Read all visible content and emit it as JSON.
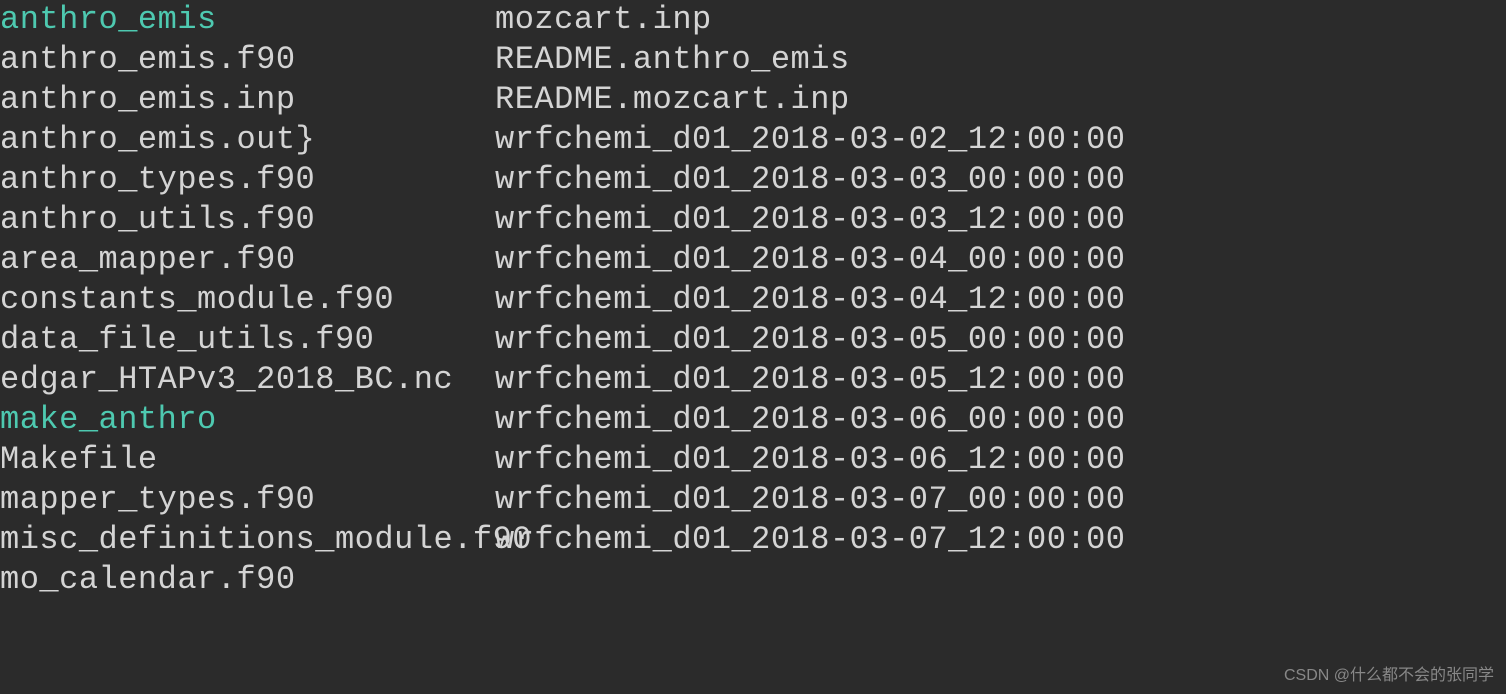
{
  "listing": {
    "col1": [
      {
        "name": "anthro_emis",
        "type": "executable"
      },
      {
        "name": "anthro_emis.f90",
        "type": "regular"
      },
      {
        "name": "anthro_emis.inp",
        "type": "regular"
      },
      {
        "name": "anthro_emis.out}",
        "type": "regular"
      },
      {
        "name": "anthro_types.f90",
        "type": "regular"
      },
      {
        "name": "anthro_utils.f90",
        "type": "regular"
      },
      {
        "name": "area_mapper.f90",
        "type": "regular"
      },
      {
        "name": "constants_module.f90",
        "type": "regular"
      },
      {
        "name": "data_file_utils.f90",
        "type": "regular"
      },
      {
        "name": "edgar_HTAPv3_2018_BC.nc",
        "type": "regular"
      },
      {
        "name": "make_anthro",
        "type": "executable"
      },
      {
        "name": "Makefile",
        "type": "regular"
      },
      {
        "name": "mapper_types.f90",
        "type": "regular"
      },
      {
        "name": "misc_definitions_module.f90",
        "type": "regular"
      },
      {
        "name": "mo_calendar.f90",
        "type": "regular"
      }
    ],
    "col2": [
      {
        "name": "mozcart.inp",
        "type": "regular"
      },
      {
        "name": "README.anthro_emis",
        "type": "regular"
      },
      {
        "name": "README.mozcart.inp",
        "type": "regular"
      },
      {
        "name": "wrfchemi_d01_2018-03-02_12:00:00",
        "type": "regular"
      },
      {
        "name": "wrfchemi_d01_2018-03-03_00:00:00",
        "type": "regular"
      },
      {
        "name": "wrfchemi_d01_2018-03-03_12:00:00",
        "type": "regular"
      },
      {
        "name": "wrfchemi_d01_2018-03-04_00:00:00",
        "type": "regular"
      },
      {
        "name": "wrfchemi_d01_2018-03-04_12:00:00",
        "type": "regular"
      },
      {
        "name": "wrfchemi_d01_2018-03-05_00:00:00",
        "type": "regular"
      },
      {
        "name": "wrfchemi_d01_2018-03-05_12:00:00",
        "type": "regular"
      },
      {
        "name": "wrfchemi_d01_2018-03-06_00:00:00",
        "type": "regular"
      },
      {
        "name": "wrfchemi_d01_2018-03-06_12:00:00",
        "type": "regular"
      },
      {
        "name": "wrfchemi_d01_2018-03-07_00:00:00",
        "type": "regular"
      },
      {
        "name": "wrfchemi_d01_2018-03-07_12:00:00",
        "type": "regular"
      }
    ]
  },
  "watermark": "CSDN @什么都不会的张同学"
}
